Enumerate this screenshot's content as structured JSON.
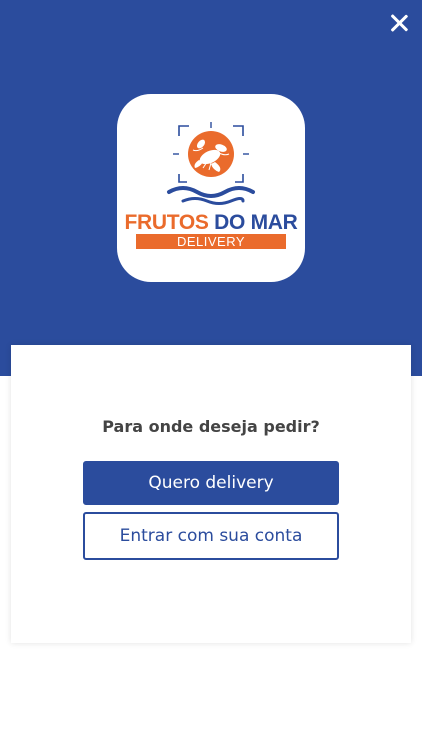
{
  "colors": {
    "brand_blue": "#2b4c9d",
    "brand_orange": "#ea6b2c",
    "text_dark": "#444444",
    "background": "#ffffff"
  },
  "header": {
    "close_icon": "close-icon"
  },
  "logo": {
    "title_word1": "FRUTOS",
    "title_word2": "DO MAR",
    "subtitle": "DELIVERY",
    "emblem_icon": "lobster-icon"
  },
  "card": {
    "question": "Para onde deseja pedir?",
    "primary_button_label": "Quero delivery",
    "secondary_button_label": "Entrar com sua conta"
  }
}
